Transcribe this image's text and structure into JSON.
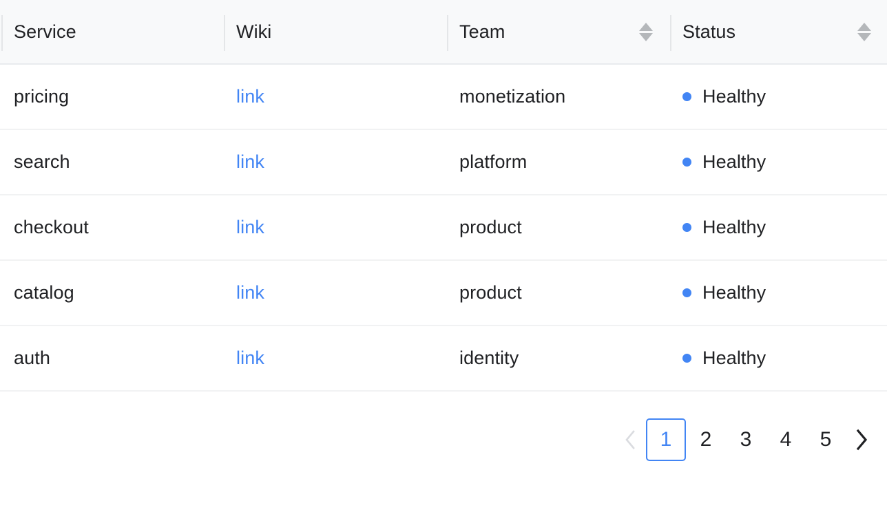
{
  "table": {
    "columns": [
      {
        "label": "Service",
        "sortable": false,
        "sort_icon": "sort-arrows-icon"
      },
      {
        "label": "Wiki",
        "sortable": false,
        "sort_icon": "sort-arrows-icon"
      },
      {
        "label": "Team",
        "sortable": true,
        "sort_icon": "sort-arrows-icon"
      },
      {
        "label": "Status",
        "sortable": true,
        "sort_icon": "sort-arrows-icon"
      }
    ],
    "rows": [
      {
        "service": "pricing",
        "wiki": "link",
        "team": "monetization",
        "status": "Healthy",
        "status_color": "#4285f4"
      },
      {
        "service": "search",
        "wiki": "link",
        "team": "platform",
        "status": "Healthy",
        "status_color": "#4285f4"
      },
      {
        "service": "checkout",
        "wiki": "link",
        "team": "product",
        "status": "Healthy",
        "status_color": "#4285f4"
      },
      {
        "service": "catalog",
        "wiki": "link",
        "team": "product",
        "status": "Healthy",
        "status_color": "#4285f4"
      },
      {
        "service": "auth",
        "wiki": "link",
        "team": "identity",
        "status": "Healthy",
        "status_color": "#4285f4"
      }
    ]
  },
  "pagination": {
    "prev_icon": "chevron-left-icon",
    "next_icon": "chevron-right-icon",
    "prev_enabled": false,
    "next_enabled": true,
    "pages": [
      "1",
      "2",
      "3",
      "4",
      "5"
    ],
    "current_page": "1"
  },
  "colors": {
    "accent": "#4285f4",
    "link": "#4285f4",
    "text": "#202124",
    "header_bg": "#f8f9fa",
    "row_border": "#f1f2f3",
    "header_border": "#e9ebee",
    "sort_icon": "#b4b7ba",
    "disabled_arrow": "#dadce0"
  }
}
